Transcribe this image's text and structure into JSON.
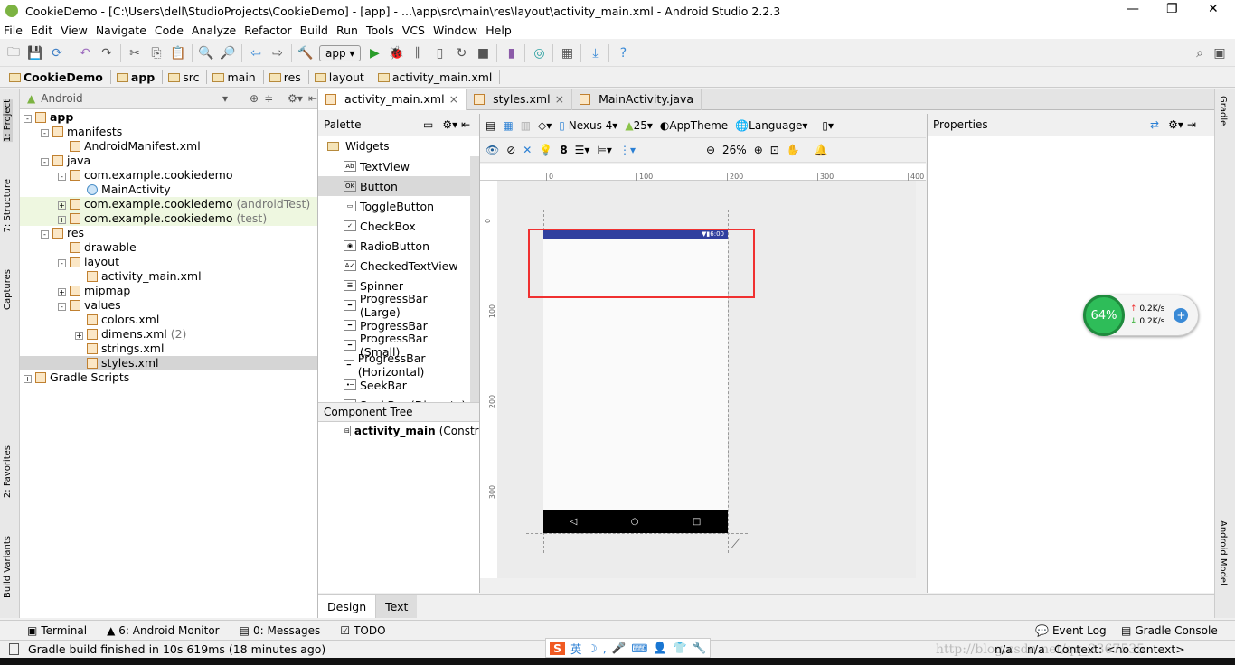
{
  "title": "CookieDemo - [C:\\Users\\dell\\StudioProjects\\CookieDemo] - [app] - ...\\app\\src\\main\\res\\layout\\activity_main.xml - Android Studio 2.2.3",
  "menu": [
    "File",
    "Edit",
    "View",
    "Navigate",
    "Code",
    "Analyze",
    "Refactor",
    "Build",
    "Run",
    "Tools",
    "VCS",
    "Window",
    "Help"
  ],
  "toolbar": {
    "run_config": "app"
  },
  "breadcrumb": [
    "CookieDemo",
    "app",
    "src",
    "main",
    "res",
    "layout",
    "activity_main.xml"
  ],
  "left_strip": [
    "1: Project",
    "7: Structure",
    "Captures",
    "2: Favorites",
    "Build Variants"
  ],
  "right_strip": [
    "Gradle",
    "Android Model"
  ],
  "project": {
    "view": "Android",
    "tree": [
      {
        "label": "app",
        "level": 0,
        "bold": true,
        "exp": "-"
      },
      {
        "label": "manifests",
        "level": 1,
        "exp": "-"
      },
      {
        "label": "AndroidManifest.xml",
        "level": 2
      },
      {
        "label": "java",
        "level": 1,
        "exp": "-"
      },
      {
        "label": "com.example.cookiedemo",
        "level": 2,
        "exp": "-"
      },
      {
        "label": "MainActivity",
        "level": 3,
        "cls": true
      },
      {
        "label": "com.example.cookiedemo",
        "ext": "(androidTest)",
        "level": 2,
        "exp": "+",
        "hl": true
      },
      {
        "label": "com.example.cookiedemo",
        "ext": "(test)",
        "level": 2,
        "exp": "+",
        "hl": true
      },
      {
        "label": "res",
        "level": 1,
        "exp": "-"
      },
      {
        "label": "drawable",
        "level": 2
      },
      {
        "label": "layout",
        "level": 2,
        "exp": "-"
      },
      {
        "label": "activity_main.xml",
        "level": 3
      },
      {
        "label": "mipmap",
        "level": 2,
        "exp": "+"
      },
      {
        "label": "values",
        "level": 2,
        "exp": "-"
      },
      {
        "label": "colors.xml",
        "level": 3
      },
      {
        "label": "dimens.xml",
        "ext": "(2)",
        "level": 3,
        "exp": "+"
      },
      {
        "label": "strings.xml",
        "level": 3
      },
      {
        "label": "styles.xml",
        "level": 3,
        "sel": true
      },
      {
        "label": "Gradle Scripts",
        "level": 0,
        "exp": "+"
      }
    ]
  },
  "tabs": [
    {
      "label": "activity_main.xml",
      "active": true
    },
    {
      "label": "styles.xml"
    },
    {
      "label": "MainActivity.java"
    }
  ],
  "palette": {
    "title": "Palette",
    "group": "Widgets",
    "items": [
      "TextView",
      "Button",
      "ToggleButton",
      "CheckBox",
      "RadioButton",
      "CheckedTextView",
      "Spinner",
      "ProgressBar (Large)",
      "ProgressBar",
      "ProgressBar (Small)",
      "ProgressBar (Horizontal)",
      "SeekBar",
      "SeekBar (Discrete)"
    ],
    "selected": "Button"
  },
  "component_tree": {
    "title": "Component Tree",
    "root": "activity_main",
    "root_ext": "(ConstraintLayout)"
  },
  "design_toolbar": {
    "device": "Nexus 4",
    "api": "25",
    "theme": "AppTheme",
    "language": "Language",
    "margin": "8",
    "zoom": "26%"
  },
  "ruler": [
    "0",
    "100",
    "200",
    "300",
    "400"
  ],
  "vruler": [
    "0",
    "100",
    "200",
    "300"
  ],
  "phone": {
    "time": "6:00",
    "status_color": "#303f9f"
  },
  "properties": {
    "title": "Properties"
  },
  "design_tabs": [
    "Design",
    "Text"
  ],
  "net_widget": {
    "percent": "64%",
    "up": "0.2K/s",
    "down": "0.2K/s"
  },
  "bottom_tools": [
    "Terminal",
    "6: Android Monitor",
    "0: Messages",
    "TODO"
  ],
  "bottom_right": [
    "Event Log",
    "Gradle Console"
  ],
  "status": {
    "message": "Gradle build finished in 10s 619ms (18 minutes ago)",
    "pos1": "n/a",
    "pos2": "n/a",
    "context": "Context: <no context>",
    "watermark": "http://blog.csdn.net/qq_2367535"
  },
  "ime": "英"
}
